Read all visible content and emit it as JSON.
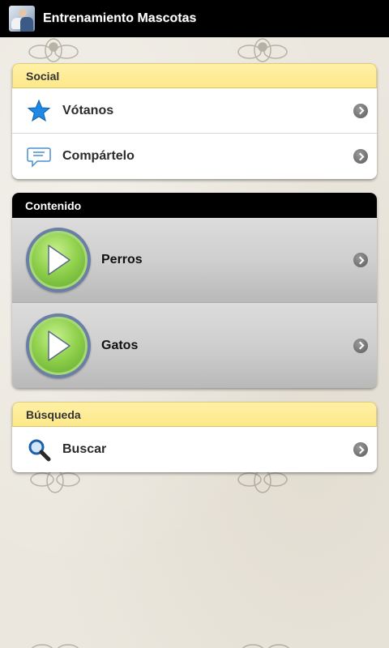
{
  "app": {
    "title": "Entrenamiento Mascotas",
    "icon": "app-icon"
  },
  "colors": {
    "header_light": "#fde88a",
    "header_dark": "#000000",
    "play_green": "#8fd04c",
    "star_blue": "#1e88e5"
  },
  "social": {
    "header": "Social",
    "items": [
      {
        "label": "Vótanos",
        "icon": "star-icon"
      },
      {
        "label": "Compártelo",
        "icon": "speech-bubble-icon"
      }
    ]
  },
  "contenido": {
    "header": "Contenido",
    "items": [
      {
        "label": "Perros",
        "icon": "play-icon"
      },
      {
        "label": "Gatos",
        "icon": "play-icon"
      }
    ]
  },
  "busqueda": {
    "header": "Búsqueda",
    "items": [
      {
        "label": "Buscar",
        "icon": "magnifier-icon"
      }
    ]
  }
}
